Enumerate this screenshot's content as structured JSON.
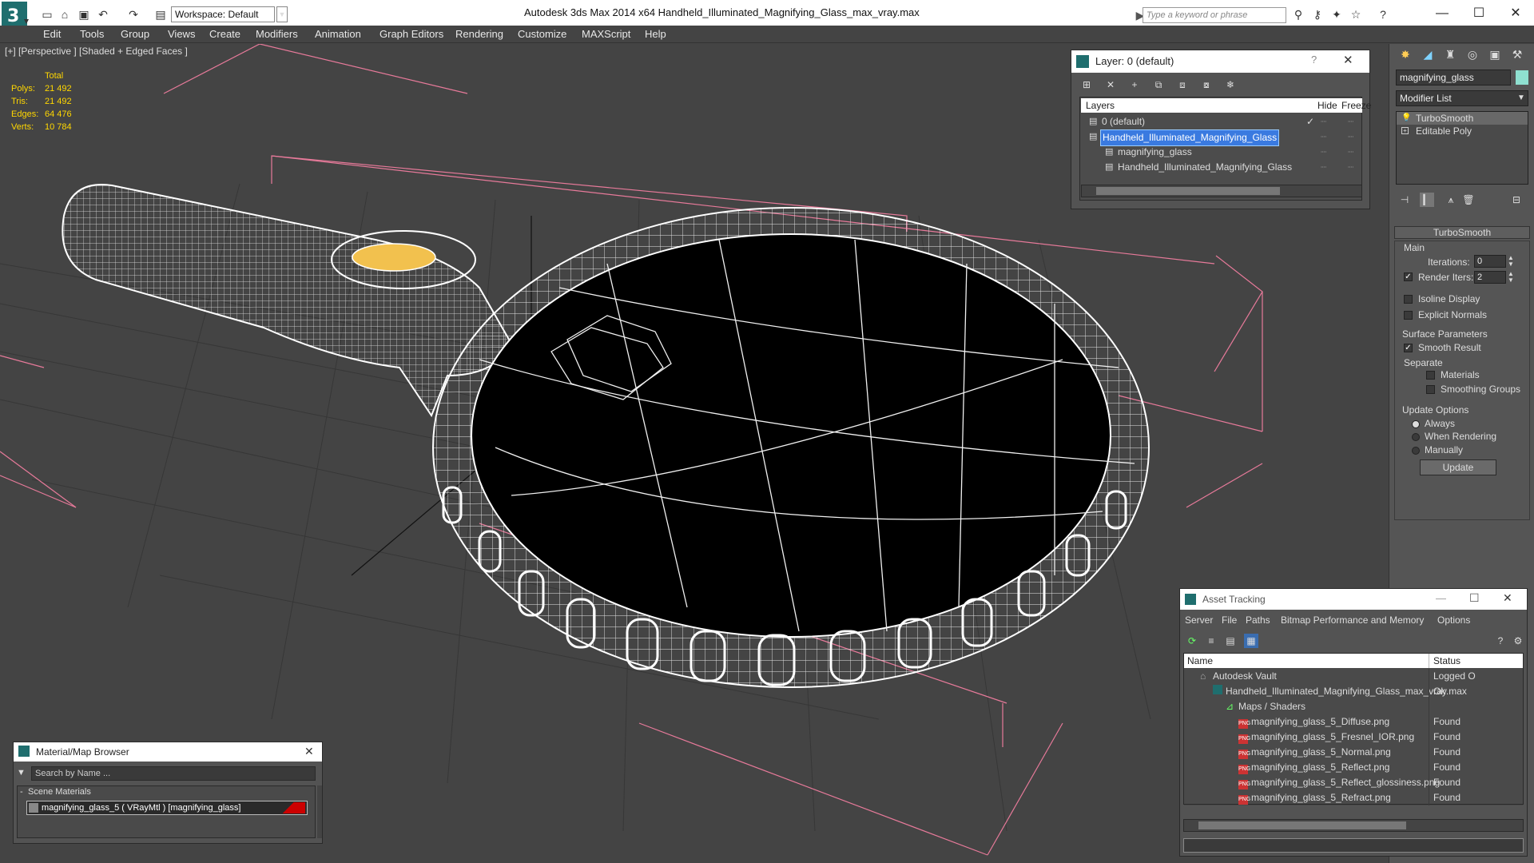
{
  "app": {
    "title": "Autodesk 3ds Max  2014 x64     Handheld_Illuminated_Magnifying_Glass_max_vray.max",
    "workspace": "Workspace: Default",
    "search_placeholder": "Type a keyword or phrase"
  },
  "menu": [
    "Edit",
    "Tools",
    "Group",
    "Views",
    "Create",
    "Modifiers",
    "Animation",
    "Graph Editors",
    "Rendering",
    "Customize",
    "MAXScript",
    "Help"
  ],
  "viewport": {
    "label": "[+] [Perspective ] [Shaded + Edged Faces ]",
    "stats": {
      "total_label": "Total",
      "rows": [
        {
          "label": "Polys:",
          "value": "21 492"
        },
        {
          "label": "Tris:",
          "value": "21 492"
        },
        {
          "label": "Edges:",
          "value": "64 476"
        },
        {
          "label": "Verts:",
          "value": "10 784"
        }
      ]
    }
  },
  "layer_window": {
    "title": "Layer: 0 (default)",
    "columns": {
      "layers": "Layers",
      "hide": "Hide",
      "freeze": "Freeze"
    },
    "rows": [
      {
        "name": "0 (default)",
        "indent": 0,
        "selected": false
      },
      {
        "name": "Handheld_Illuminated_Magnifying_Glass",
        "indent": 0,
        "selected": true
      },
      {
        "name": "magnifying_glass",
        "indent": 1,
        "selected": false
      },
      {
        "name": "Handheld_Illuminated_Magnifying_Glass",
        "indent": 1,
        "selected": false
      }
    ]
  },
  "command_panel": {
    "object_name": "magnifying_glass",
    "modifier_list": "Modifier List",
    "stack": [
      "TurboSmooth",
      "Editable Poly"
    ],
    "rollout": "TurboSmooth",
    "main": "Main",
    "iterations_label": "Iterations:",
    "iterations_value": "0",
    "render_iters_label": "Render Iters:",
    "render_iters_value": "2",
    "isoline": "Isoline Display",
    "explicit": "Explicit Normals",
    "surface_params": "Surface Parameters",
    "smooth_result": "Smooth Result",
    "separate": "Separate",
    "materials": "Materials",
    "smoothing_groups": "Smoothing Groups",
    "update_options": "Update Options",
    "always": "Always",
    "when_rendering": "When Rendering",
    "manually": "Manually",
    "update_button": "Update"
  },
  "material_browser": {
    "title": "Material/Map Browser",
    "search_placeholder": "Search by Name ...",
    "group": "Scene Materials",
    "item": "magnifying_glass_5  ( VRayMtl ) [magnifying_glass]"
  },
  "asset_tracking": {
    "title": "Asset Tracking",
    "menu": [
      "Server",
      "File",
      "Paths",
      "Bitmap Performance and Memory",
      "Options"
    ],
    "columns": {
      "name": "Name",
      "status": "Status"
    },
    "rows": [
      {
        "name": "Autodesk Vault",
        "status": "Logged O",
        "indent": 1,
        "icon": "vault"
      },
      {
        "name": "Handheld_Illuminated_Magnifying_Glass_max_vray.max",
        "status": "Ok",
        "indent": 2,
        "icon": "max"
      },
      {
        "name": "Maps / Shaders",
        "status": "",
        "indent": 3,
        "icon": "maps"
      },
      {
        "name": "magnifying_glass_5_Diffuse.png",
        "status": "Found",
        "indent": 4,
        "icon": "png"
      },
      {
        "name": "magnifying_glass_5_Fresnel_IOR.png",
        "status": "Found",
        "indent": 4,
        "icon": "png"
      },
      {
        "name": "magnifying_glass_5_Normal.png",
        "status": "Found",
        "indent": 4,
        "icon": "png"
      },
      {
        "name": "magnifying_glass_5_Reflect.png",
        "status": "Found",
        "indent": 4,
        "icon": "png"
      },
      {
        "name": "magnifying_glass_5_Reflect_glossiness.png",
        "status": "Found",
        "indent": 4,
        "icon": "png"
      },
      {
        "name": "magnifying_glass_5_Refract.png",
        "status": "Found",
        "indent": 4,
        "icon": "png"
      }
    ]
  }
}
